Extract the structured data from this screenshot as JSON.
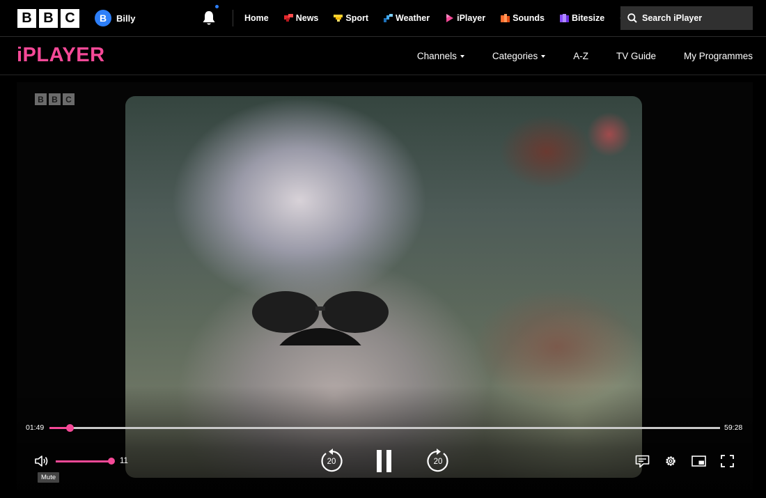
{
  "topbar": {
    "logo_letters": [
      "B",
      "B",
      "C"
    ],
    "account": {
      "initial": "B",
      "name": "Billy",
      "avatar_color": "#2d7ff9"
    },
    "nav": [
      {
        "label": "Home",
        "icon": "none"
      },
      {
        "label": "News",
        "icon": "news-icon",
        "color": "#e3262b"
      },
      {
        "label": "Sport",
        "icon": "sport-icon",
        "color": "#ffd230"
      },
      {
        "label": "Weather",
        "icon": "weather-icon",
        "color": "#3fa9f5"
      },
      {
        "label": "iPlayer",
        "icon": "iplayer-icon",
        "color": "#f54997"
      },
      {
        "label": "Sounds",
        "icon": "sounds-icon",
        "color": "#ff6d2d"
      },
      {
        "label": "Bitesize",
        "icon": "bitesize-icon",
        "color": "#8a4fff"
      }
    ],
    "more_label": "•••",
    "search_label": "Search iPlayer"
  },
  "iplayer_bar": {
    "logo": "iPLAYER",
    "brand_color": "#f54997",
    "nav": [
      {
        "label": "Channels",
        "dropdown": true
      },
      {
        "label": "Categories",
        "dropdown": true
      },
      {
        "label": "A-Z",
        "dropdown": false
      },
      {
        "label": "TV Guide",
        "dropdown": false
      },
      {
        "label": "My Programmes",
        "dropdown": false
      }
    ]
  },
  "player": {
    "watermark_letters": [
      "B",
      "B",
      "C"
    ],
    "elapsed": "01:49",
    "duration": "59:28",
    "progress_fraction": 0.0305,
    "volume_value": "11",
    "volume_fraction": 1.0,
    "mute_tooltip": "Mute",
    "skip_back_seconds": "20",
    "skip_forward_seconds": "20",
    "state": "playing",
    "accent_color": "#f54997"
  }
}
